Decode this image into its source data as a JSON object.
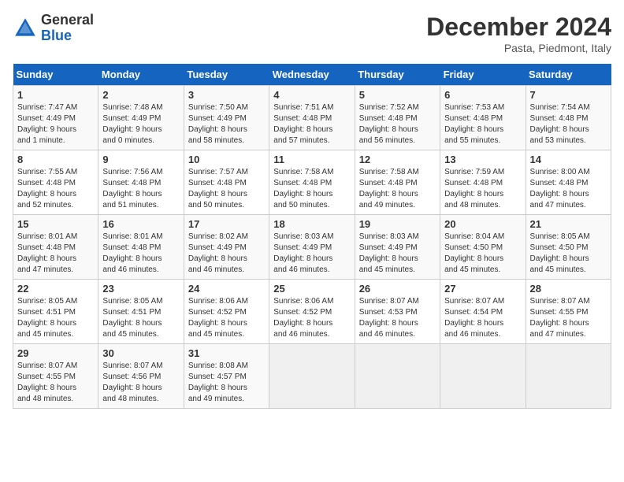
{
  "header": {
    "logo_general": "General",
    "logo_blue": "Blue",
    "month_title": "December 2024",
    "subtitle": "Pasta, Piedmont, Italy"
  },
  "days_of_week": [
    "Sunday",
    "Monday",
    "Tuesday",
    "Wednesday",
    "Thursday",
    "Friday",
    "Saturday"
  ],
  "weeks": [
    [
      {
        "day": "1",
        "info": "Sunrise: 7:47 AM\nSunset: 4:49 PM\nDaylight: 9 hours\nand 1 minute."
      },
      {
        "day": "2",
        "info": "Sunrise: 7:48 AM\nSunset: 4:49 PM\nDaylight: 9 hours\nand 0 minutes."
      },
      {
        "day": "3",
        "info": "Sunrise: 7:50 AM\nSunset: 4:49 PM\nDaylight: 8 hours\nand 58 minutes."
      },
      {
        "day": "4",
        "info": "Sunrise: 7:51 AM\nSunset: 4:48 PM\nDaylight: 8 hours\nand 57 minutes."
      },
      {
        "day": "5",
        "info": "Sunrise: 7:52 AM\nSunset: 4:48 PM\nDaylight: 8 hours\nand 56 minutes."
      },
      {
        "day": "6",
        "info": "Sunrise: 7:53 AM\nSunset: 4:48 PM\nDaylight: 8 hours\nand 55 minutes."
      },
      {
        "day": "7",
        "info": "Sunrise: 7:54 AM\nSunset: 4:48 PM\nDaylight: 8 hours\nand 53 minutes."
      }
    ],
    [
      {
        "day": "8",
        "info": "Sunrise: 7:55 AM\nSunset: 4:48 PM\nDaylight: 8 hours\nand 52 minutes."
      },
      {
        "day": "9",
        "info": "Sunrise: 7:56 AM\nSunset: 4:48 PM\nDaylight: 8 hours\nand 51 minutes."
      },
      {
        "day": "10",
        "info": "Sunrise: 7:57 AM\nSunset: 4:48 PM\nDaylight: 8 hours\nand 50 minutes."
      },
      {
        "day": "11",
        "info": "Sunrise: 7:58 AM\nSunset: 4:48 PM\nDaylight: 8 hours\nand 50 minutes."
      },
      {
        "day": "12",
        "info": "Sunrise: 7:58 AM\nSunset: 4:48 PM\nDaylight: 8 hours\nand 49 minutes."
      },
      {
        "day": "13",
        "info": "Sunrise: 7:59 AM\nSunset: 4:48 PM\nDaylight: 8 hours\nand 48 minutes."
      },
      {
        "day": "14",
        "info": "Sunrise: 8:00 AM\nSunset: 4:48 PM\nDaylight: 8 hours\nand 47 minutes."
      }
    ],
    [
      {
        "day": "15",
        "info": "Sunrise: 8:01 AM\nSunset: 4:48 PM\nDaylight: 8 hours\nand 47 minutes."
      },
      {
        "day": "16",
        "info": "Sunrise: 8:01 AM\nSunset: 4:48 PM\nDaylight: 8 hours\nand 46 minutes."
      },
      {
        "day": "17",
        "info": "Sunrise: 8:02 AM\nSunset: 4:49 PM\nDaylight: 8 hours\nand 46 minutes."
      },
      {
        "day": "18",
        "info": "Sunrise: 8:03 AM\nSunset: 4:49 PM\nDaylight: 8 hours\nand 46 minutes."
      },
      {
        "day": "19",
        "info": "Sunrise: 8:03 AM\nSunset: 4:49 PM\nDaylight: 8 hours\nand 45 minutes."
      },
      {
        "day": "20",
        "info": "Sunrise: 8:04 AM\nSunset: 4:50 PM\nDaylight: 8 hours\nand 45 minutes."
      },
      {
        "day": "21",
        "info": "Sunrise: 8:05 AM\nSunset: 4:50 PM\nDaylight: 8 hours\nand 45 minutes."
      }
    ],
    [
      {
        "day": "22",
        "info": "Sunrise: 8:05 AM\nSunset: 4:51 PM\nDaylight: 8 hours\nand 45 minutes."
      },
      {
        "day": "23",
        "info": "Sunrise: 8:05 AM\nSunset: 4:51 PM\nDaylight: 8 hours\nand 45 minutes."
      },
      {
        "day": "24",
        "info": "Sunrise: 8:06 AM\nSunset: 4:52 PM\nDaylight: 8 hours\nand 45 minutes."
      },
      {
        "day": "25",
        "info": "Sunrise: 8:06 AM\nSunset: 4:52 PM\nDaylight: 8 hours\nand 46 minutes."
      },
      {
        "day": "26",
        "info": "Sunrise: 8:07 AM\nSunset: 4:53 PM\nDaylight: 8 hours\nand 46 minutes."
      },
      {
        "day": "27",
        "info": "Sunrise: 8:07 AM\nSunset: 4:54 PM\nDaylight: 8 hours\nand 46 minutes."
      },
      {
        "day": "28",
        "info": "Sunrise: 8:07 AM\nSunset: 4:55 PM\nDaylight: 8 hours\nand 47 minutes."
      }
    ],
    [
      {
        "day": "29",
        "info": "Sunrise: 8:07 AM\nSunset: 4:55 PM\nDaylight: 8 hours\nand 48 minutes."
      },
      {
        "day": "30",
        "info": "Sunrise: 8:07 AM\nSunset: 4:56 PM\nDaylight: 8 hours\nand 48 minutes."
      },
      {
        "day": "31",
        "info": "Sunrise: 8:08 AM\nSunset: 4:57 PM\nDaylight: 8 hours\nand 49 minutes."
      },
      {
        "day": "",
        "info": ""
      },
      {
        "day": "",
        "info": ""
      },
      {
        "day": "",
        "info": ""
      },
      {
        "day": "",
        "info": ""
      }
    ]
  ]
}
